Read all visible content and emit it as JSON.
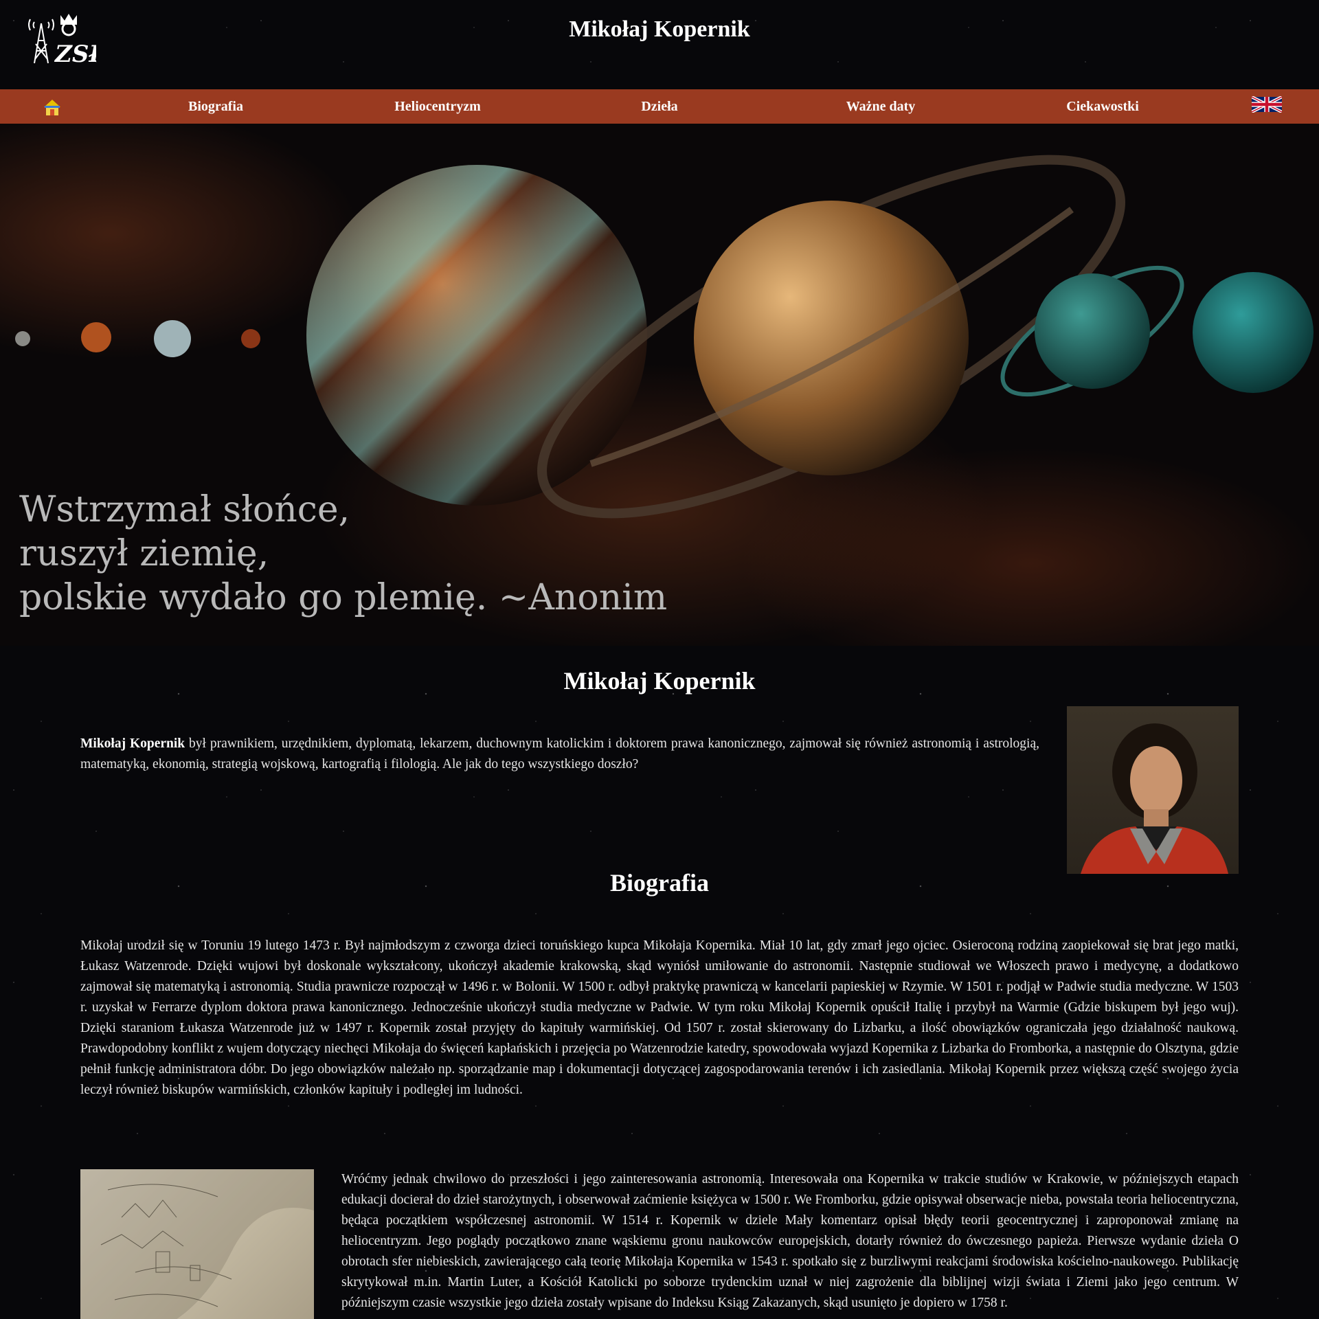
{
  "header": {
    "title": "Mikołaj Kopernik",
    "logo_text": "ZSŁ"
  },
  "nav": {
    "home_icon": "home-icon",
    "items": [
      {
        "label": "Biografia"
      },
      {
        "label": "Heliocentryzm"
      },
      {
        "label": "Dzieła"
      },
      {
        "label": "Ważne daty"
      },
      {
        "label": "Ciekawostki"
      }
    ],
    "language_icon": "uk-flag-icon",
    "bg_color": "#9a3a20"
  },
  "hero": {
    "quote_lines": [
      "Wstrzymał słońce,",
      "ruszył ziemię,",
      "polskie wydało go plemię. ~Anonim"
    ]
  },
  "intro": {
    "title": "Mikołaj Kopernik",
    "name_bold": "Mikołaj Kopernik",
    "text": " był prawnikiem, urzędnikiem, dyplomatą, lekarzem, duchownym katolickim i doktorem prawa kanonicznego, zajmował się również astronomią i astrologią, matematyką, ekonomią, strategią wojskową, kartografią i filologią. Ale jak do tego wszystkiego doszło?"
  },
  "biography": {
    "title": "Biografia",
    "text": "Mikołaj urodził się w Toruniu 19 lutego 1473 r. Był najmłodszym z czworga dzieci toruńskiego kupca Mikołaja Kopernika. Miał 10 lat, gdy zmarł jego ojciec. Osieroconą rodziną zaopiekował się brat jego matki, Łukasz Watzenrode. Dzięki wujowi był doskonale wykształcony, ukończył akademie krakowską, skąd wyniósł umiłowanie do astronomii. Następnie studiował we Włoszech prawo i medycynę, a dodatkowo zajmował się matematyką i astronomią. Studia prawnicze rozpoczął w 1496 r. w Bolonii. W 1500 r. odbył praktykę prawniczą w kancelarii papieskiej w Rzymie. W 1501 r. podjął w Padwie studia medyczne. W 1503 r. uzyskał w Ferrarze dyplom doktora prawa kanonicznego. Jednocześnie ukończył studia medyczne w Padwie. W tym roku Mikołaj Kopernik opuścił Italię i przybył na Warmie (Gdzie biskupem był jego wuj). Dzięki staraniom Łukasza Watzenrode już w 1497 r. Kopernik został przyjęty do kapituły warmińskiej. Od 1507 r. został skierowany do Lizbarku, a ilość obowiązków ograniczała jego działalność naukową. Prawdopodobny konflikt z wujem dotyczący niechęci Mikołaja do święceń kapłańskich i przejęcia po Watzenrodzie katedry, spowodowała wyjazd Kopernika z Lizbarka do Fromborka, a następnie do Olsztyna, gdzie pełnił funkcję administratora dóbr. Do jego obowiązków należało np. sporządzanie map i dokumentacji dotyczącej zagospodarowania terenów i ich zasiedlania. Mikołaj Kopernik przez większą część swojego życia leczył również biskupów warmińskich, członków kapituły i podległej im ludności.",
    "text2": "Wróćmy jednak chwilowo do przeszłości i jego zainteresowania astronomią. Interesowała ona Kopernika w trakcie studiów w Krakowie, w późniejszych etapach edukacji docierał do dzieł starożytnych, i obserwował zaćmienie księżyca w 1500 r. We Fromborku, gdzie opisywał obserwacje nieba, powstała teoria heliocentryczna, będąca początkiem współczesnej astronomii. W 1514 r. Kopernik w dziele Mały komentarz opisał błędy teorii geocentrycznej i zaproponował zmianę na heliocentryzm. Jego poglądy początkowo znane wąskiemu gronu naukowców europejskich, dotarły również do ówczesnego papieża. Pierwsze wydanie dzieła O obrotach sfer niebieskich, zawierającego całą teorię Mikołaja Kopernika w 1543 r. spotkało się z burzliwymi reakcjami środowiska kościelno-naukowego. Publikację skrytykował m.in. Martin Luter, a Kościół Katolicki po soborze trydenckim uznał w niej zagrożenie dla biblijnej wizji świata i Ziemi jako jego centrum. W późniejszym czasie wszystkie jego dzieła zostały wpisane do Indeksu Ksiąg Zakazanych, skąd usunięto je dopiero w 1758 r."
  }
}
